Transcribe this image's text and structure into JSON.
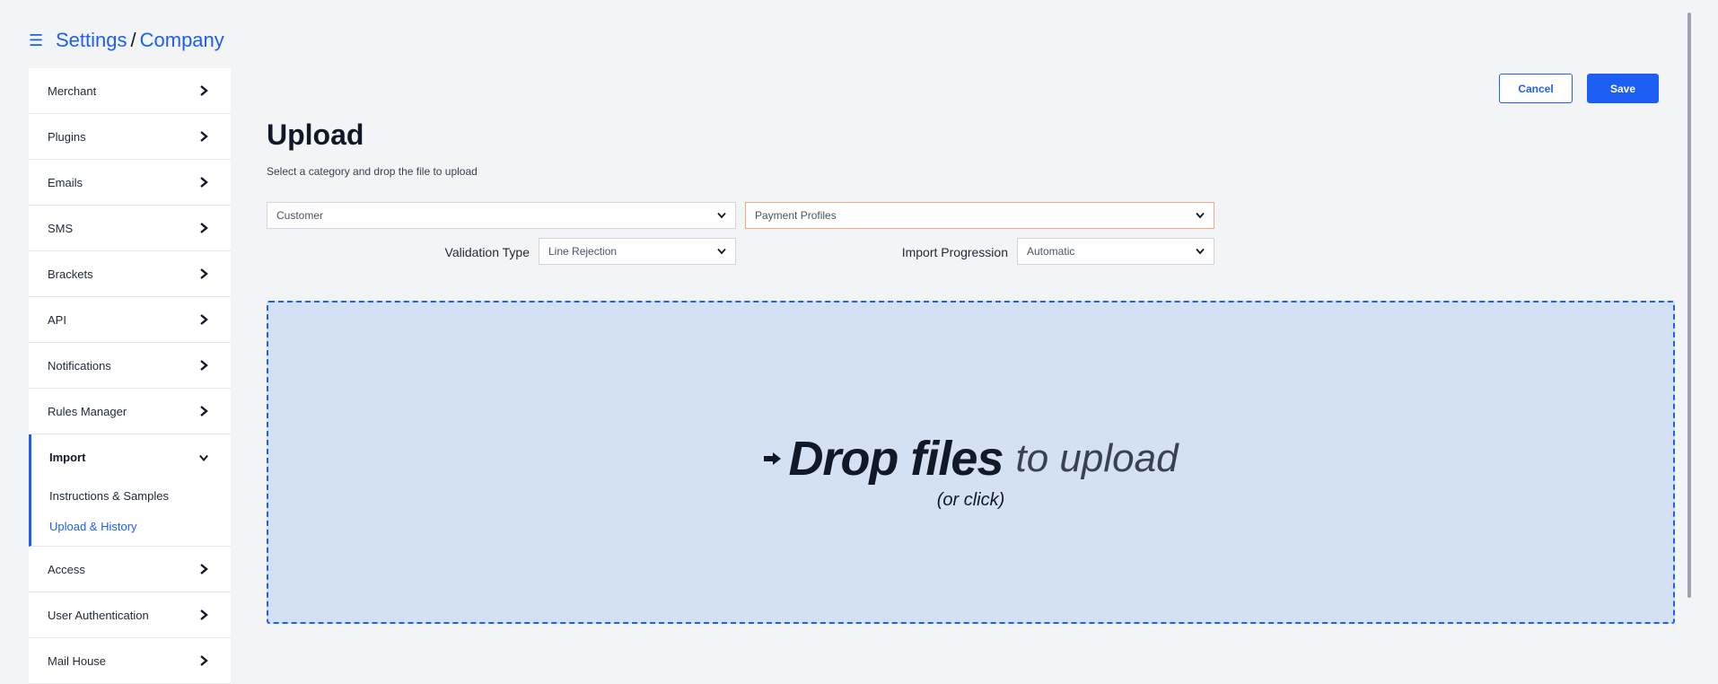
{
  "breadcrumb": {
    "root": "Settings",
    "separator": "/",
    "current": "Company"
  },
  "sidebar": {
    "items_top": [
      {
        "label": "Merchant"
      },
      {
        "label": "Plugins"
      },
      {
        "label": "Emails"
      },
      {
        "label": "SMS"
      },
      {
        "label": "Brackets"
      },
      {
        "label": "API"
      },
      {
        "label": "Notifications"
      },
      {
        "label": "Rules Manager"
      }
    ],
    "expanded": {
      "label": "Import",
      "children": [
        {
          "label": "Instructions & Samples"
        },
        {
          "label": "Upload & History",
          "active": true
        }
      ]
    },
    "items_bottom": [
      {
        "label": "Access"
      },
      {
        "label": "User Authentication"
      },
      {
        "label": "Mail House"
      }
    ]
  },
  "actions": {
    "cancel": "Cancel",
    "save": "Save"
  },
  "main": {
    "title": "Upload",
    "subtitle": "Select a category and drop the file to upload",
    "category_select": {
      "value": "Customer"
    },
    "type_select": {
      "value": "Payment Profiles"
    },
    "validation": {
      "label": "Validation Type",
      "value": "Line Rejection"
    },
    "progression": {
      "label": "Import Progression",
      "value": "Automatic"
    }
  },
  "dropzone": {
    "strong": "Drop files",
    "light": "to upload",
    "hint": "(or click)"
  },
  "colors": {
    "accent": "#1d5ff5",
    "dropzone_bg": "#d4e0f3",
    "warning_border": "#f0a585"
  }
}
